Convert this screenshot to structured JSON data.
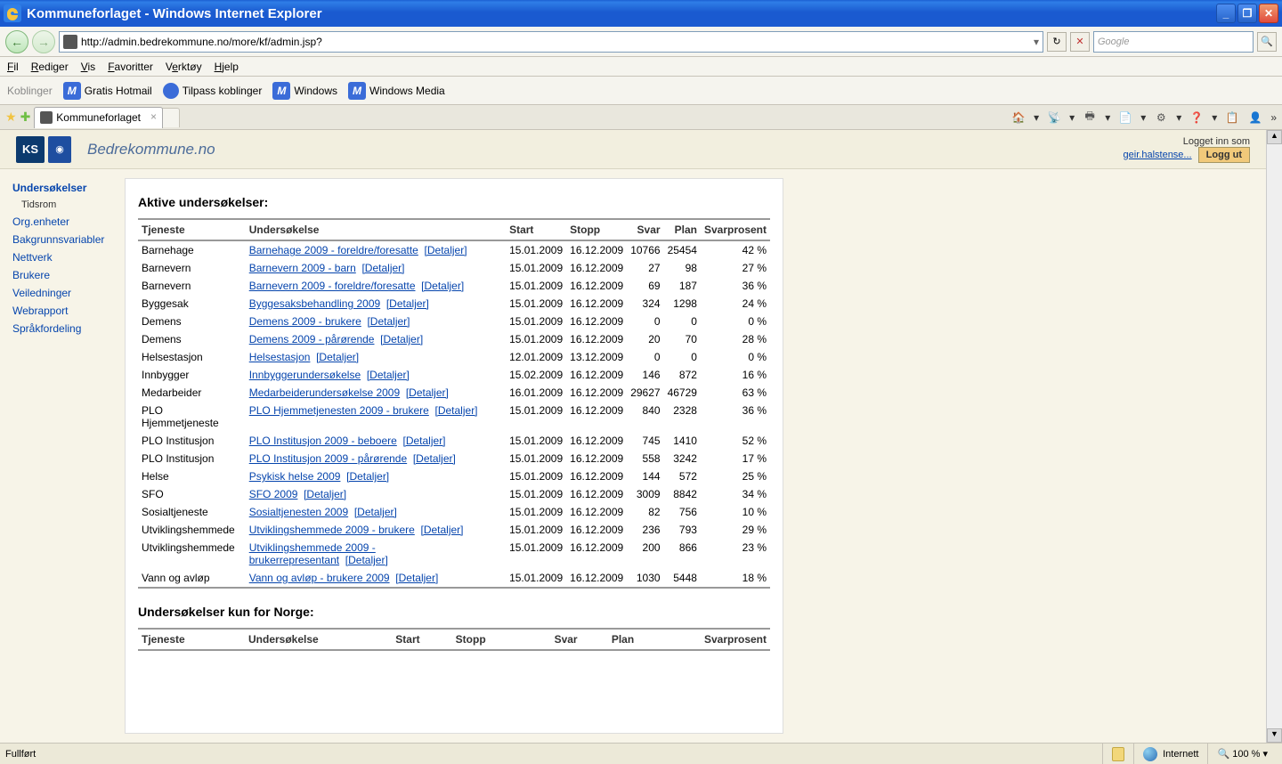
{
  "window": {
    "title": "Kommuneforlaget - Windows Internet Explorer"
  },
  "address": {
    "url": "http://admin.bedrekommune.no/more/kf/admin.jsp?"
  },
  "search_placeholder": "Google",
  "menus": [
    "Fil",
    "Rediger",
    "Vis",
    "Favoritter",
    "Verktøy",
    "Hjelp"
  ],
  "linksbar": {
    "label": "Koblinger",
    "items": [
      "Gratis Hotmail",
      "Tilpass koblinger",
      "Windows",
      "Windows Media"
    ]
  },
  "tab_title": "Kommuneforlaget",
  "site": {
    "name": "Bedrekommune.no",
    "logged_in_as_label": "Logget inn som",
    "username": "geir.halstense...",
    "logout": "Logg ut"
  },
  "leftnav": [
    {
      "label": "Undersøkelser",
      "active": true,
      "sub": "Tidsrom"
    },
    {
      "label": "Org.enheter"
    },
    {
      "label": "Bakgrunnsvariabler"
    },
    {
      "label": "Nettverk"
    },
    {
      "label": "Brukere"
    },
    {
      "label": "Veiledninger"
    },
    {
      "label": "Webrapport"
    },
    {
      "label": "Språkfordeling"
    }
  ],
  "main": {
    "heading1": "Aktive undersøkelser:",
    "heading2": "Undersøkelser kun for Norge:",
    "details_label": "[Detaljer]",
    "cols": {
      "tjeneste": "Tjeneste",
      "undersokelse": "Undersøkelse",
      "start": "Start",
      "stopp": "Stopp",
      "svar": "Svar",
      "plan": "Plan",
      "svarprosent": "Svarprosent"
    },
    "rows": [
      {
        "t": "Barnehage",
        "u": "Barnehage 2009 - foreldre/foresatte",
        "s": "15.01.2009",
        "p": "16.12.2009",
        "sv": "10766",
        "pl": "25454",
        "pc": "42 %"
      },
      {
        "t": "Barnevern",
        "u": "Barnevern 2009 - barn",
        "s": "15.01.2009",
        "p": "16.12.2009",
        "sv": "27",
        "pl": "98",
        "pc": "27 %"
      },
      {
        "t": "Barnevern",
        "u": "Barnevern 2009 - foreldre/foresatte",
        "s": "15.01.2009",
        "p": "16.12.2009",
        "sv": "69",
        "pl": "187",
        "pc": "36 %"
      },
      {
        "t": "Byggesak",
        "u": "Byggesaksbehandling 2009",
        "s": "15.01.2009",
        "p": "16.12.2009",
        "sv": "324",
        "pl": "1298",
        "pc": "24 %"
      },
      {
        "t": "Demens",
        "u": "Demens 2009 - brukere",
        "s": "15.01.2009",
        "p": "16.12.2009",
        "sv": "0",
        "pl": "0",
        "pc": "0 %"
      },
      {
        "t": "Demens",
        "u": "Demens 2009 - pårørende",
        "s": "15.01.2009",
        "p": "16.12.2009",
        "sv": "20",
        "pl": "70",
        "pc": "28 %"
      },
      {
        "t": "Helsestasjon",
        "u": "Helsestasjon",
        "s": "12.01.2009",
        "p": "13.12.2009",
        "sv": "0",
        "pl": "0",
        "pc": "0 %"
      },
      {
        "t": "Innbygger",
        "u": "Innbyggerundersøkelse",
        "s": "15.02.2009",
        "p": "16.12.2009",
        "sv": "146",
        "pl": "872",
        "pc": "16 %"
      },
      {
        "t": "Medarbeider",
        "u": "Medarbeiderundersøkelse 2009",
        "s": "16.01.2009",
        "p": "16.12.2009",
        "sv": "29627",
        "pl": "46729",
        "pc": "63 %"
      },
      {
        "t": "PLO Hjemmetjeneste",
        "u": "PLO Hjemmetjenesten 2009 - brukere",
        "s": "15.01.2009",
        "p": "16.12.2009",
        "sv": "840",
        "pl": "2328",
        "pc": "36 %"
      },
      {
        "t": "PLO Institusjon",
        "u": "PLO Institusjon 2009 - beboere",
        "s": "15.01.2009",
        "p": "16.12.2009",
        "sv": "745",
        "pl": "1410",
        "pc": "52 %"
      },
      {
        "t": "PLO Institusjon",
        "u": "PLO Institusjon 2009 - pårørende",
        "s": "15.01.2009",
        "p": "16.12.2009",
        "sv": "558",
        "pl": "3242",
        "pc": "17 %"
      },
      {
        "t": "Helse",
        "u": "Psykisk helse 2009",
        "s": "15.01.2009",
        "p": "16.12.2009",
        "sv": "144",
        "pl": "572",
        "pc": "25 %"
      },
      {
        "t": "SFO",
        "u": "SFO 2009",
        "s": "15.01.2009",
        "p": "16.12.2009",
        "sv": "3009",
        "pl": "8842",
        "pc": "34 %"
      },
      {
        "t": "Sosialtjeneste",
        "u": "Sosialtjenesten 2009",
        "s": "15.01.2009",
        "p": "16.12.2009",
        "sv": "82",
        "pl": "756",
        "pc": "10 %"
      },
      {
        "t": "Utviklingshemmede",
        "u": "Utviklingshemmede 2009 - brukere",
        "s": "15.01.2009",
        "p": "16.12.2009",
        "sv": "236",
        "pl": "793",
        "pc": "29 %"
      },
      {
        "t": "Utviklingshemmede",
        "u": "Utviklingshemmede 2009 - brukerrepresentant",
        "s": "15.01.2009",
        "p": "16.12.2009",
        "sv": "200",
        "pl": "866",
        "pc": "23 %"
      },
      {
        "t": "Vann og avløp",
        "u": "Vann og avløp - brukere 2009",
        "s": "15.01.2009",
        "p": "16.12.2009",
        "sv": "1030",
        "pl": "5448",
        "pc": "18 %"
      }
    ]
  },
  "statusbar": {
    "left": "Fullført",
    "zone": "Internett",
    "zoom": "100 %"
  }
}
